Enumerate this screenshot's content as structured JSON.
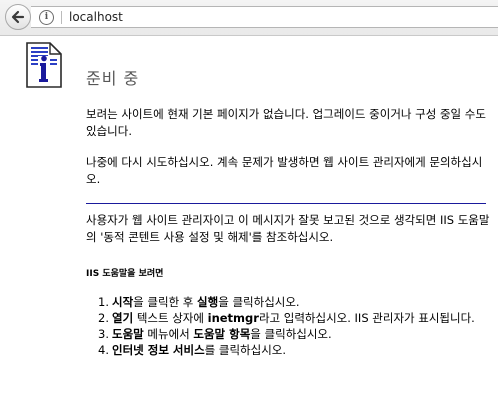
{
  "browser": {
    "url": "localhost",
    "back_icon": "back-arrow-icon",
    "info_icon": "site-info-icon"
  },
  "page": {
    "title": "준비 중",
    "icon": "document-info-icon",
    "paragraph1": "보려는 사이트에 현재 기본 페이지가 없습니다. 업그레이드 중이거나 구성 중일 수도 있습니다.",
    "paragraph2": "나중에 다시 시도하십시오. 계속 문제가 발생하면 웹 사이트 관리자에게 문의하십시오.",
    "paragraph3": "사용자가 웹 사이트 관리자이고 이 메시지가 잘못 보고된 것으로 생각되면 IIS 도움말의 '동적 콘텐트 사용 설정 및 해제'를 참조하십시오.",
    "help_heading": "IIS 도움말을 보려면",
    "steps": [
      {
        "num": "1.",
        "b1": "시작",
        "t1": "을 클릭한 후 ",
        "b2": "실행",
        "t2": "을 클릭하십시오."
      },
      {
        "num": "2.",
        "b1": "열기",
        "t1": " 텍스트 상자에 ",
        "b2": "inetmgr",
        "t2": "라고 입력하십시오. IIS 관리자가 표시됩니다."
      },
      {
        "num": "3.",
        "b1": "도움말",
        "t1": " 메뉴에서 ",
        "b2": "도움말 항목",
        "t2": "을 클릭하십시오."
      },
      {
        "num": "4.",
        "b1": "인터넷 정보 서비스",
        "t1": "를 클릭하십시오.",
        "b2": "",
        "t2": ""
      }
    ]
  },
  "colors": {
    "rule": "#1a1a9c",
    "icon_blue": "#2b3fc4",
    "title_gray": "#575757"
  }
}
